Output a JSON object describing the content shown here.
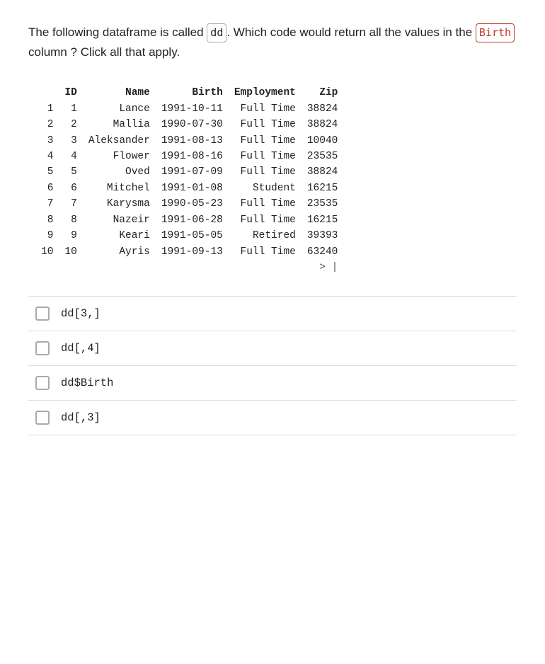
{
  "question": {
    "part1": "The following dataframe is called ",
    "dd_badge": "dd",
    "part2": ". Which code would return all the values in the ",
    "birth_badge": "Birth",
    "part3": " column ?  Click all that apply."
  },
  "dataframe": {
    "headers": [
      "ID",
      "Name",
      "Birth",
      "Employment",
      "Zip"
    ],
    "rows": [
      [
        "1",
        "1",
        "Lance",
        "1991-10-11",
        "Full Time",
        "38824"
      ],
      [
        "2",
        "2",
        "Mallia",
        "1990-07-30",
        "Full Time",
        "38824"
      ],
      [
        "3",
        "3",
        "Aleksander",
        "1991-08-13",
        "Full Time",
        "10040"
      ],
      [
        "4",
        "4",
        "Flower",
        "1991-08-16",
        "Full Time",
        "23535"
      ],
      [
        "5",
        "5",
        "Oved",
        "1991-07-09",
        "Full Time",
        "38824"
      ],
      [
        "6",
        "6",
        "Mitchel",
        "1991-01-08",
        "Student",
        "16215"
      ],
      [
        "7",
        "7",
        "Karysma",
        "1990-05-23",
        "Full Time",
        "23535"
      ],
      [
        "8",
        "8",
        "Nazeir",
        "1991-06-28",
        "Full Time",
        "16215"
      ],
      [
        "9",
        "9",
        "Keari",
        "1991-05-05",
        "Retired",
        "39393"
      ],
      [
        "10",
        "10",
        "Ayris",
        "1991-09-13",
        "Full Time",
        "63240"
      ]
    ]
  },
  "options": [
    {
      "id": "opt1",
      "label": "dd[3,]"
    },
    {
      "id": "opt2",
      "label": "dd[,4]"
    },
    {
      "id": "opt3",
      "label": "dd$Birth"
    },
    {
      "id": "opt4",
      "label": "dd[,3]"
    }
  ]
}
